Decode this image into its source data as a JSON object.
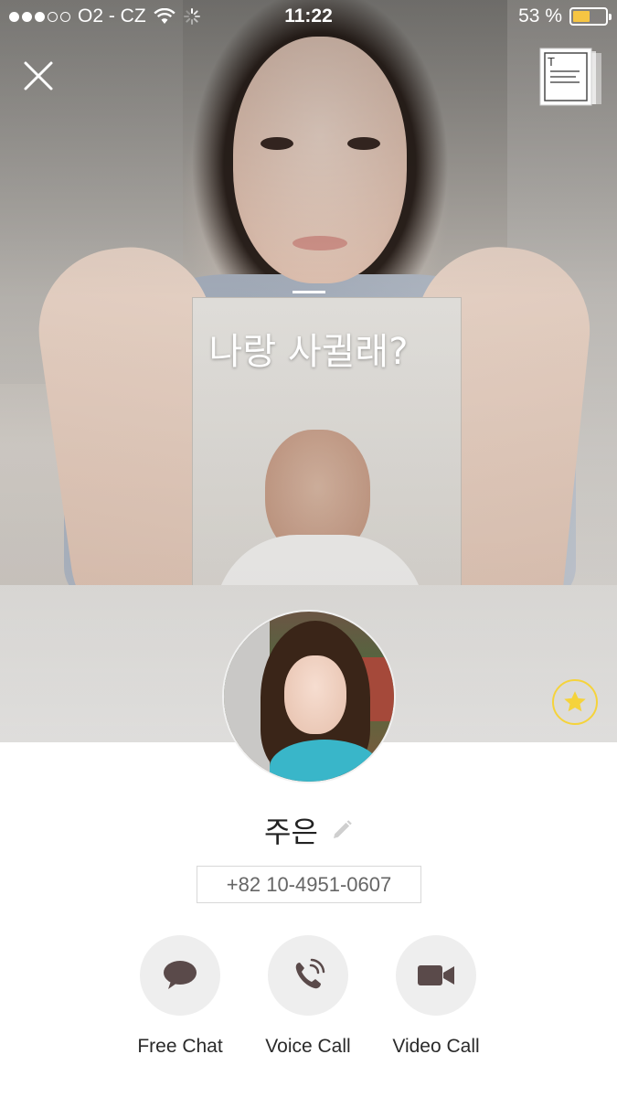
{
  "status_bar": {
    "signal_dots_filled": 3,
    "signal_dots_total": 5,
    "carrier": "O2 - CZ",
    "time": "11:22",
    "battery_percent": "53 %",
    "battery_level": 0.53,
    "battery_color": "#f6c543"
  },
  "cover": {
    "status_message": "나랑 사귈래?"
  },
  "controls": {
    "close_icon": "close-icon",
    "story_icon": "story-stack-icon",
    "favorite_icon": "star-icon",
    "favorite_color": "#f5d33b"
  },
  "profile": {
    "name": "주은",
    "phone": "+82 10-4951-0607"
  },
  "actions": [
    {
      "label": "Free Chat",
      "icon": "chat-bubble-icon"
    },
    {
      "label": "Voice Call",
      "icon": "phone-icon"
    },
    {
      "label": "Video Call",
      "icon": "video-camera-icon"
    }
  ],
  "colors": {
    "action_icon": "#5a4a4a",
    "action_bg": "#eeeeee"
  }
}
